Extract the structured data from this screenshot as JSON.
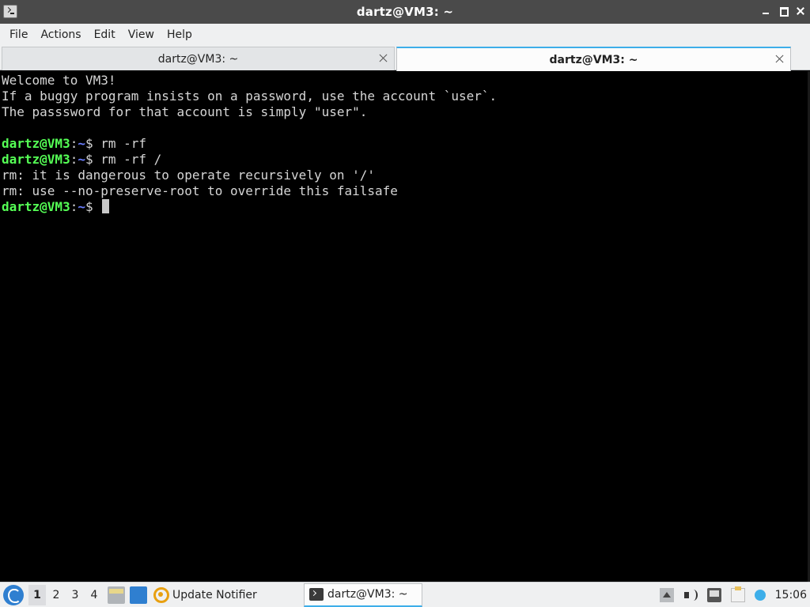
{
  "window": {
    "title": "dartz@VM3: ~",
    "icon": "terminal-icon"
  },
  "menu": [
    "File",
    "Actions",
    "Edit",
    "View",
    "Help"
  ],
  "tabs": [
    {
      "label": "dartz@VM3: ~",
      "active": false
    },
    {
      "label": "dartz@VM3: ~",
      "active": true
    }
  ],
  "terminal": {
    "motd": [
      "Welcome to VM3!",
      "If a buggy program insists on a password, use the account `user`.",
      "The passsword for that account is simply \"user\"."
    ],
    "prompt": {
      "user": "dartz@VM3",
      "sep": ":",
      "path": "~",
      "symbol": "$ "
    },
    "commands": [
      {
        "input": "rm -rf",
        "output": []
      },
      {
        "input": "rm -rf /",
        "output": [
          "rm: it is dangerous to operate recursively on '/'",
          "rm: use --no-preserve-root to override this failsafe"
        ]
      }
    ],
    "colors": {
      "user": "#55ff55",
      "path": "#6b7fff",
      "text": "#d6d6d6",
      "background": "#000000"
    }
  },
  "taskbar": {
    "start_icon": "lxqt-start-icon",
    "desktops": [
      "1",
      "2",
      "3",
      "4"
    ],
    "current_desktop": "1",
    "quicklaunch": [
      "file-manager-icon",
      "show-desktop-icon"
    ],
    "tasks": [
      {
        "label": "Update Notifier",
        "icon": "update-notifier-icon"
      },
      {
        "label": "dartz@VM3: ~",
        "icon": "terminal-icon",
        "active": true
      }
    ],
    "tray": [
      "show-hidden-icon",
      "volume-icon",
      "network-icon",
      "clipboard-icon",
      "notification-icon"
    ],
    "clock": "15:06"
  },
  "accent": "#3daee9"
}
